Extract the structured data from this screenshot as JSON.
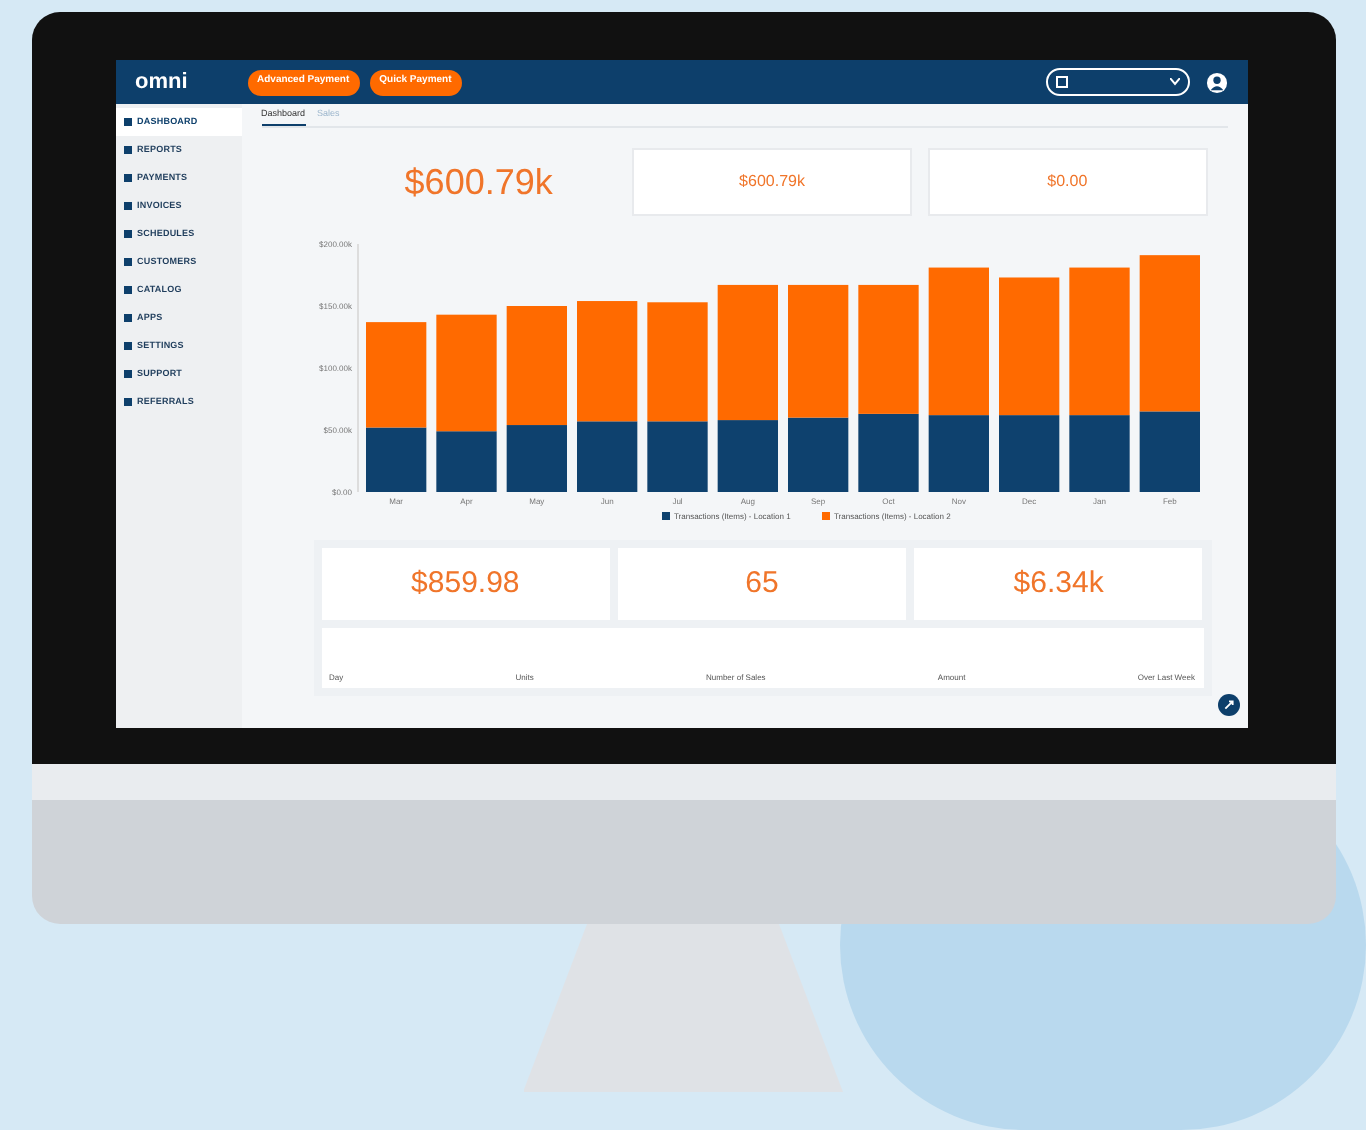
{
  "header": {
    "logo": "omni",
    "buttons": [
      "Advanced Payment",
      "Quick Payment"
    ]
  },
  "sidebar": {
    "items": [
      {
        "label": "DASHBOARD",
        "selected": true
      },
      {
        "label": "REPORTS",
        "selected": false
      },
      {
        "label": "PAYMENTS",
        "selected": false
      },
      {
        "label": "INVOICES",
        "selected": false
      },
      {
        "label": "SCHEDULES",
        "selected": false
      },
      {
        "label": "CUSTOMERS",
        "selected": false
      },
      {
        "label": "CATALOG",
        "selected": false
      },
      {
        "label": "APPS",
        "selected": false
      },
      {
        "label": "SETTINGS",
        "selected": false
      },
      {
        "label": "SUPPORT",
        "selected": false
      },
      {
        "label": "REFERRALS",
        "selected": false
      }
    ]
  },
  "tabs": [
    {
      "label": "Dashboard",
      "selected": true
    },
    {
      "label": "Sales",
      "selected": false
    }
  ],
  "top_stats": [
    {
      "value": "$600.79k"
    },
    {
      "value": "$600.79k"
    },
    {
      "value": "$0.00"
    }
  ],
  "chart_data": {
    "type": "bar",
    "stacked": true,
    "categories": [
      "Mar",
      "Apr",
      "May",
      "Jun",
      "Jul",
      "Aug",
      "Sep",
      "Oct",
      "Nov",
      "Dec",
      "Jan",
      "Feb"
    ],
    "series": [
      {
        "name": "Transactions (Items) - Location 1",
        "color": "#0e416e",
        "values": [
          52,
          49,
          54,
          57,
          57,
          58,
          60,
          63,
          62,
          62,
          62,
          65
        ]
      },
      {
        "name": "Transactions (Items) - Location 2",
        "color": "#ff6a00",
        "values": [
          85,
          94,
          96,
          97,
          96,
          109,
          107,
          104,
          119,
          111,
          119,
          126
        ]
      }
    ],
    "legend": true,
    "ylim": [
      0,
      200
    ],
    "yticks": [
      {
        "value": 0,
        "label": "$0.00"
      },
      {
        "value": 50,
        "label": "$50.00k"
      },
      {
        "value": 100,
        "label": "$100.00k"
      },
      {
        "value": 150,
        "label": "$150.00k"
      },
      {
        "value": 200,
        "label": "$200.00k"
      }
    ]
  },
  "bottom_stats": [
    {
      "value": "$859.98"
    },
    {
      "value": "65"
    },
    {
      "value": "$6.34k"
    }
  ],
  "table": {
    "columns": [
      "Day",
      "Units",
      "Number of Sales",
      "Amount",
      "Over Last Week"
    ]
  }
}
